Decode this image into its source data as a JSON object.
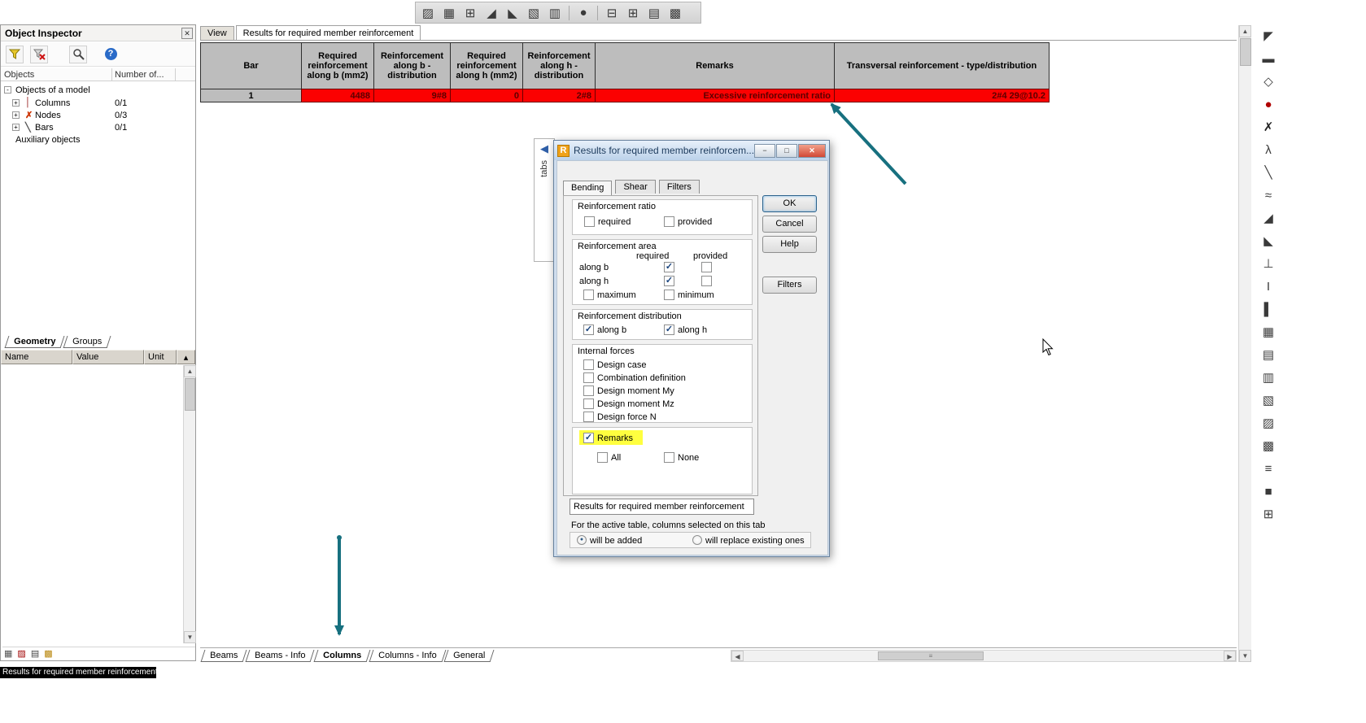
{
  "statusbar": {
    "text": "Results for required member reinforcement"
  },
  "colors": {
    "alert_row": "#fb0101",
    "highlight": "#ffff3f",
    "annotation_arrow": "#17707f"
  },
  "top_toolbar": {
    "icons": [
      {
        "name": "map-icon",
        "glyph": "▨"
      },
      {
        "name": "mesh-icon",
        "glyph": "▦"
      },
      {
        "name": "table-icon",
        "glyph": "⊞"
      },
      {
        "name": "diagram-icon",
        "glyph": "◢"
      },
      {
        "name": "stress-icon",
        "glyph": "◣"
      },
      {
        "name": "hatch-icon",
        "glyph": "▧"
      },
      {
        "name": "section-icon",
        "glyph": "▥"
      },
      {
        "name": "node-icon",
        "glyph": "●"
      },
      {
        "name": "beam-table-icon",
        "glyph": "⊟"
      },
      {
        "name": "column-table-icon",
        "glyph": "⊞"
      },
      {
        "name": "results-table-icon",
        "glyph": "▤"
      },
      {
        "name": "layout-icon",
        "glyph": "▩"
      }
    ]
  },
  "right_toolbar": {
    "icons": [
      {
        "name": "pointer-icon",
        "glyph": "◤"
      },
      {
        "name": "bar-icon",
        "glyph": "▬"
      },
      {
        "name": "node-icon",
        "glyph": "◇"
      },
      {
        "name": "support-icon",
        "glyph": "●"
      },
      {
        "name": "release-icon",
        "glyph": "✗"
      },
      {
        "name": "load-icon",
        "glyph": "λ"
      },
      {
        "name": "slope-icon",
        "glyph": "╲"
      },
      {
        "name": "spring-icon",
        "glyph": "≈"
      },
      {
        "name": "ramp-up-icon",
        "glyph": "◢"
      },
      {
        "name": "ramp-down-icon",
        "glyph": "◣"
      },
      {
        "name": "fixed-support-icon",
        "glyph": "⊥"
      },
      {
        "name": "ibeam-icon",
        "glyph": "I"
      },
      {
        "name": "wall-icon",
        "glyph": "▌"
      },
      {
        "name": "mesh2-icon",
        "glyph": "▦"
      },
      {
        "name": "slab-icon",
        "glyph": "▤"
      },
      {
        "name": "section2-icon",
        "glyph": "▥"
      },
      {
        "name": "hatch2-icon",
        "glyph": "▧"
      },
      {
        "name": "grid-icon",
        "glyph": "▨"
      },
      {
        "name": "pattern-icon",
        "glyph": "▩"
      },
      {
        "name": "list-icon",
        "glyph": "≡"
      },
      {
        "name": "block-icon",
        "glyph": "■"
      },
      {
        "name": "table2-icon",
        "glyph": "⊞"
      }
    ]
  },
  "inspector": {
    "title": "Object Inspector",
    "close_glyph": "✕",
    "help_glyph": "?",
    "header": {
      "objects": "Objects",
      "number": "Number of..."
    },
    "tree": {
      "root": {
        "label": "Objects of a model",
        "expander": "-"
      },
      "items": [
        {
          "expander": "+",
          "icon": "│",
          "label": "Columns",
          "count": "0/1"
        },
        {
          "expander": "+",
          "icon": "✗",
          "label": "Nodes",
          "count": "0/3"
        },
        {
          "expander": "+",
          "icon": "╲",
          "label": "Bars",
          "count": "0/1"
        }
      ],
      "aux": "Auxiliary objects"
    },
    "tabs": {
      "geometry": "Geometry",
      "groups": "Groups"
    },
    "props": {
      "name": "Name",
      "value": "Value",
      "unit": "Unit"
    },
    "bottom_icons": [
      {
        "name": "table-small-icon",
        "glyph": "▦"
      },
      {
        "name": "flag-icon",
        "glyph": "▨"
      },
      {
        "name": "grid-small-icon",
        "glyph": "▤"
      },
      {
        "name": "notes-icon",
        "glyph": "▩"
      }
    ]
  },
  "main": {
    "tabs": {
      "view": "View",
      "results": "Results for required member reinforcement"
    },
    "table": {
      "headers": [
        "Bar",
        "Required reinforcement along b (mm2)",
        "Reinforcement along b - distribution",
        "Required reinforcement along h (mm2)",
        "Reinforcement along h - distribution",
        "Remarks",
        "Transversal reinforcement - type/distribution"
      ],
      "row": {
        "bar": "1",
        "req_b": "4488",
        "dist_b": "9#8",
        "req_h": "0",
        "dist_h": "2#8",
        "remarks": "Excessive reinforcement ratio",
        "transversal": "2#4 29@10.2"
      }
    },
    "sheet_tabs": [
      "Beams",
      "Beams - Info",
      "Columns",
      "Columns - Info",
      "General"
    ]
  },
  "dialog": {
    "icon_letter": "R",
    "title": "Results for required member reinforcem...",
    "window_buttons": {
      "minimize": "−",
      "maximize": "□",
      "close": "✕"
    },
    "tabs": {
      "bending": "Bending",
      "shear": "Shear",
      "filters": "Filters"
    },
    "ratio": {
      "title": "Reinforcement ratio",
      "required": "required",
      "provided": "provided",
      "required_check": "",
      "provided_check": ""
    },
    "area": {
      "title": "Reinforcement area",
      "col_required": "required",
      "col_provided": "provided",
      "along_b": "along b",
      "along_h": "along h",
      "maximum": "maximum",
      "minimum": "minimum",
      "b_req": "✓",
      "b_prov": "",
      "h_req": "✓",
      "h_prov": "",
      "max_check": "",
      "min_check": ""
    },
    "distribution": {
      "title": "Reinforcement distribution",
      "along_b": "along b",
      "along_h": "along h",
      "b_check": "✓",
      "h_check": "✓"
    },
    "forces": {
      "title": "Internal forces",
      "items": [
        {
          "label": "Design case",
          "check": ""
        },
        {
          "label": "Combination definition",
          "check": ""
        },
        {
          "label": "Design moment My",
          "check": ""
        },
        {
          "label": "Design moment Mz",
          "check": ""
        },
        {
          "label": "Design force N",
          "check": ""
        }
      ]
    },
    "remarks": {
      "label": "Remarks",
      "check": "✓"
    },
    "all": {
      "label": "All",
      "check": ""
    },
    "none": {
      "label": "None",
      "check": ""
    },
    "buttons": {
      "ok": "OK",
      "cancel": "Cancel",
      "help": "Help",
      "filters": "Filters"
    },
    "footer": {
      "table_name": "Results for required member reinforcement",
      "note": "For the active table, columns selected on this tab",
      "added": "will be added",
      "replace": "will replace existing ones",
      "added_dot": "●",
      "replace_dot": ""
    },
    "flyout": {
      "label": "tabs",
      "arrow": "◀"
    }
  }
}
